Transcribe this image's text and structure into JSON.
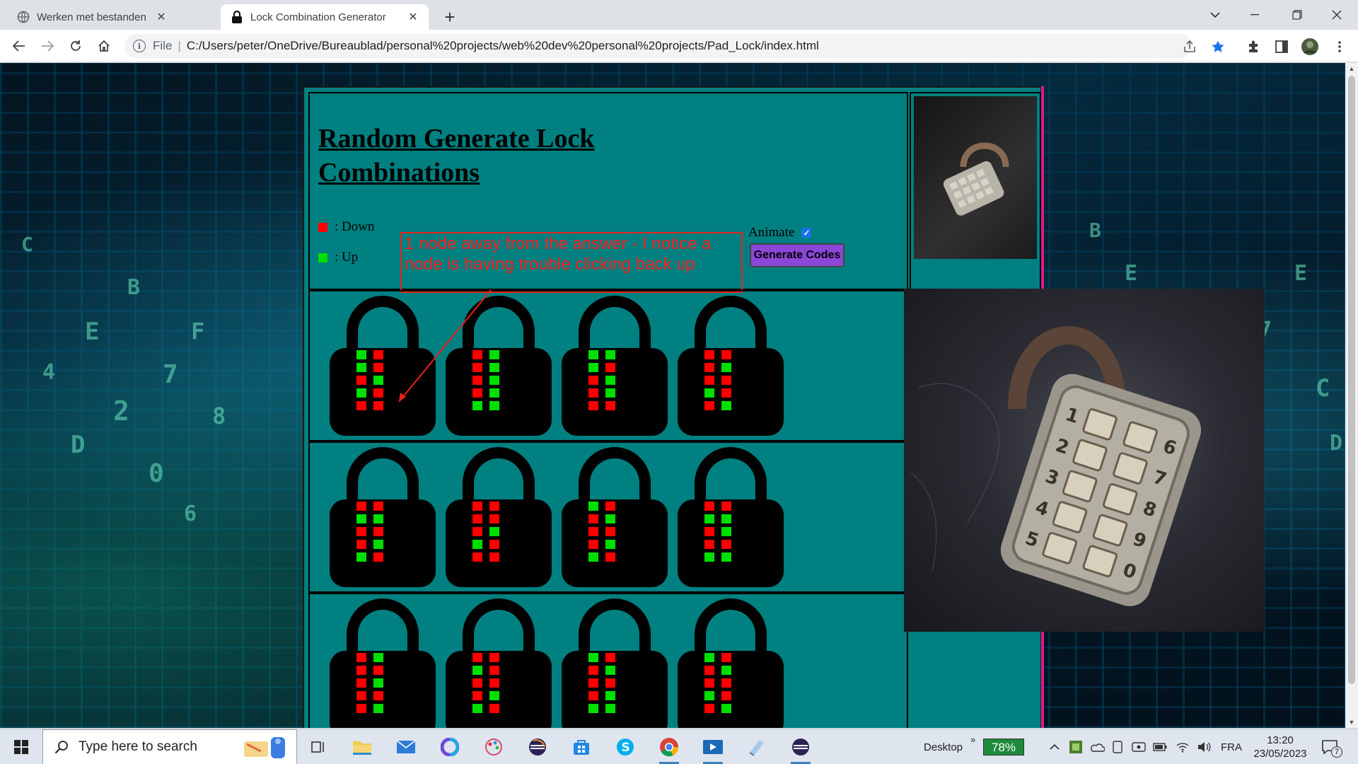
{
  "browser": {
    "tabs": [
      {
        "title": "Werken met bestanden",
        "active": false
      },
      {
        "title": "Lock Combination Generator",
        "active": true
      }
    ],
    "address": {
      "scheme_label": "File",
      "url": "C:/Users/peter/OneDrive/Bureaublad/personal%20projects/web%20dev%20personal%20projects/Pad_Lock/index.html"
    }
  },
  "page": {
    "title": "Random Generate Lock Combinations",
    "legend": {
      "down": ": Down",
      "up": ": Up"
    },
    "annotation": "1 node away from the answer - I notice a node is having trouble clicking back up",
    "animate_label": "Animate",
    "animate_checked": true,
    "generate_button": "Generate Codes",
    "colors": {
      "down": "#ff0000",
      "up": "#00e000",
      "background": "#008080"
    },
    "locks": [
      [
        [
          "up",
          "down",
          "up",
          "down",
          "down",
          "up",
          "up",
          "down",
          "down",
          "down"
        ],
        [
          "down",
          "up",
          "down",
          "up",
          "down",
          "up",
          "down",
          "up",
          "up",
          "up"
        ],
        [
          "up",
          "up",
          "up",
          "down",
          "down",
          "up",
          "down",
          "up",
          "down",
          "down"
        ],
        [
          "down",
          "down",
          "down",
          "up",
          "down",
          "down",
          "up",
          "down",
          "down",
          "up"
        ]
      ],
      [
        [
          "down",
          "down",
          "up",
          "up",
          "down",
          "down",
          "down",
          "up",
          "up",
          "down"
        ],
        [
          "down",
          "down",
          "down",
          "down",
          "down",
          "up",
          "up",
          "down",
          "down",
          "down"
        ],
        [
          "up",
          "down",
          "down",
          "up",
          "down",
          "down",
          "down",
          "up",
          "up",
          "down"
        ],
        [
          "down",
          "down",
          "up",
          "up",
          "down",
          "up",
          "down",
          "down",
          "up",
          "up"
        ]
      ],
      [
        [
          "down",
          "up",
          "down",
          "down",
          "down",
          "up",
          "down",
          "down",
          "down",
          "up"
        ],
        [
          "down",
          "down",
          "up",
          "down",
          "down",
          "down",
          "down",
          "up",
          "up",
          "down"
        ],
        [
          "up",
          "down",
          "down",
          "up",
          "down",
          "down",
          "down",
          "up",
          "up",
          "up"
        ],
        [
          "up",
          "down",
          "down",
          "up",
          "down",
          "down",
          "up",
          "down",
          "down",
          "up"
        ]
      ]
    ]
  },
  "taskbar": {
    "search_placeholder": "Type here to search",
    "desktop_label": "Desktop",
    "battery": "78%",
    "language": "FRA",
    "time": "13:20",
    "date": "23/05/2023",
    "notifications": "7",
    "apps": [
      "task-view",
      "file-explorer",
      "mail",
      "copilot",
      "paint",
      "eclipse",
      "store",
      "skype",
      "chrome",
      "media-player",
      "notepad",
      "eclipse-ide"
    ]
  }
}
